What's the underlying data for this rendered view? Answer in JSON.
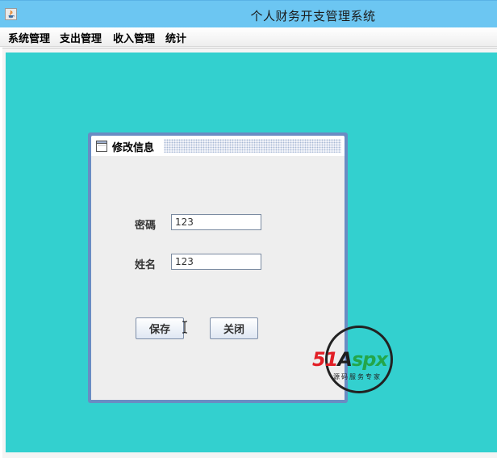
{
  "window": {
    "title": "个人财务开支管理系统",
    "icon": "java-icon"
  },
  "menu": {
    "items": [
      {
        "label": "系统管理"
      },
      {
        "label": "支出管理"
      },
      {
        "label": "收入管理"
      },
      {
        "label": "统计"
      }
    ]
  },
  "dialog": {
    "title": "修改信息",
    "icon": "window-icon",
    "fields": {
      "password": {
        "label": "密碼",
        "value": "123"
      },
      "name": {
        "label": "姓名",
        "value": "123"
      }
    },
    "buttons": {
      "save": "保存",
      "close": "关闭"
    }
  },
  "watermark": {
    "brand_51": "51",
    "brand_a": "A",
    "brand_spx": "spx",
    "tagline": "源码服务专家"
  },
  "colors": {
    "desktop": "#33d0cf",
    "titlebar": "#6cc6f2",
    "dialog_border": "#6a8cc3"
  }
}
